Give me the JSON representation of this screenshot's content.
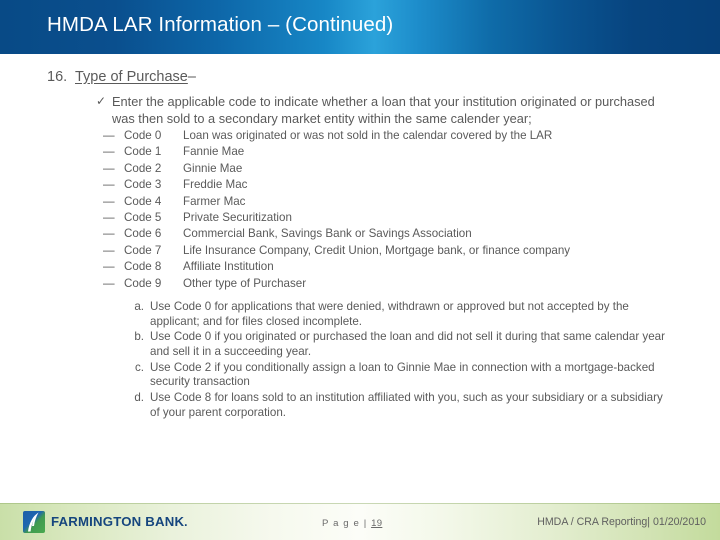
{
  "slide": {
    "title": "HMDA LAR Information – (Continued)",
    "accent_header_dark": "#084a86",
    "accent_header_light": "#2ba2da",
    "body_text_color": "#5a5a5a"
  },
  "content": {
    "item_number": "16.",
    "item_title": "Type of Purchase",
    "item_title_suffix": "–",
    "bullet_icon": "check-icon",
    "bullet_glyph": "✓",
    "bullet_text": "Enter the applicable code to indicate whether a loan that your institution originated or purchased was then sold to a secondary market entity within the same calender year;",
    "dash_glyph": "—",
    "codes": [
      {
        "dash": "—",
        "code": "Code 0",
        "desc": "Loan was originated or was not sold in the calendar covered by the LAR"
      },
      {
        "dash": "—",
        "code": "Code 1",
        "desc": "Fannie Mae"
      },
      {
        "dash": "—",
        "code": "Code 2",
        "desc": "Ginnie Mae"
      },
      {
        "dash": "—",
        "code": "Code 3",
        "desc": "Freddie Mac"
      },
      {
        "dash": "—",
        "code": "Code 4",
        "desc": "Farmer Mac"
      },
      {
        "dash": "—",
        "code": "Code 5",
        "desc": "Private Securitization"
      },
      {
        "dash": "—",
        "code": "Code 6",
        "desc": "Commercial Bank, Savings Bank or Savings Association"
      },
      {
        "dash": "—",
        "code": "Code 7",
        "desc": "Life Insurance Company, Credit Union, Mortgage bank, or finance company"
      },
      {
        "dash": "—",
        "code": "Code 8",
        "desc": "Affiliate Institution"
      },
      {
        "dash": "—",
        "code": "Code 9",
        "desc": "Other type of Purchaser"
      }
    ],
    "notes": [
      {
        "label": "a.",
        "text": "Use Code 0 for applications that were denied, withdrawn or approved but not accepted by the applicant; and for files closed incomplete."
      },
      {
        "label": "b.",
        "text": "Use Code 0 if you originated or purchased the loan and did not sell it during that same calendar year and sell it in a succeeding year."
      },
      {
        "label": "c.",
        "text": "Use Code 2 if you conditionally assign a loan to Ginnie Mae in connection with a mortgage-backed security transaction"
      },
      {
        "label": "d.",
        "text": "Use Code 8 for loans sold to an institution affiliated with you, such as your subsidiary or a subsidiary of your parent corporation."
      }
    ]
  },
  "footer": {
    "logo_name": "farmington-bank-logo",
    "logo_text": "FARMINGTON BANK",
    "logo_text_mark": ".",
    "page_prefix": "P a g e |",
    "page_number": "19",
    "right_text": "HMDA / CRA Reporting| 01/20/2010",
    "brand_blue": "#16467e",
    "brand_green": "#4aa94f"
  }
}
